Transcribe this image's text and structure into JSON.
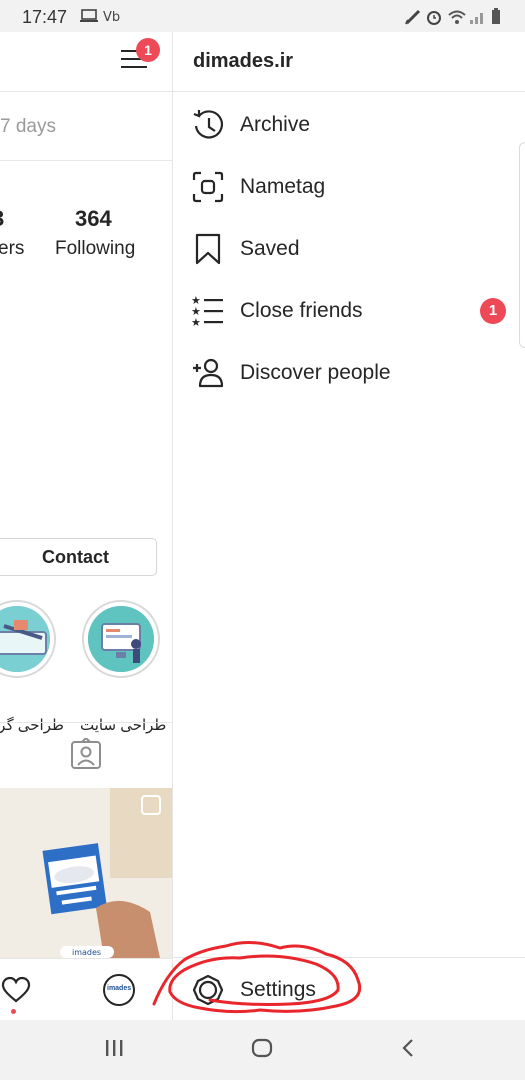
{
  "status_bar": {
    "time": "17:47",
    "icons": [
      "laptop-icon",
      "voicemail-icon",
      "edit-icon",
      "alarm-icon",
      "wifi-icon",
      "signal-icon",
      "battery-icon"
    ]
  },
  "profile_background": {
    "notification_badge": "1",
    "days_text": "7 days",
    "followers_fragment": "ers",
    "following_count": "364",
    "following_label": "Following",
    "contact_button": "Contact",
    "highlights": [
      {
        "label": "طراحی گرا"
      },
      {
        "label": "طراحی سایت"
      }
    ],
    "nav_logo_text": "imades"
  },
  "drawer": {
    "title": "dimades.ir",
    "items": [
      {
        "label": "Archive",
        "icon": "archive-clock-icon"
      },
      {
        "label": "Nametag",
        "icon": "nametag-scan-icon"
      },
      {
        "label": "Saved",
        "icon": "bookmark-icon"
      },
      {
        "label": "Close friends",
        "icon": "close-friends-list-icon",
        "badge": "1"
      },
      {
        "label": "Discover people",
        "icon": "add-person-icon"
      }
    ],
    "settings_label": "Settings"
  },
  "colors": {
    "badge": "#ed4956",
    "text": "#262626",
    "annotation": "#e8262b"
  }
}
